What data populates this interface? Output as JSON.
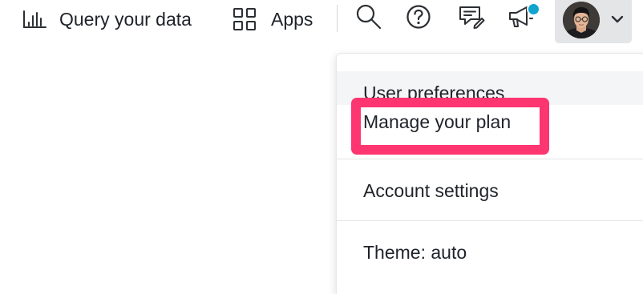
{
  "topbar": {
    "query_label": "Query your data",
    "query_icon": "bar-chart-icon",
    "apps_label": "Apps",
    "apps_icon": "grid-icon",
    "search_icon": "search-icon",
    "help_icon": "help-circle-icon",
    "feedback_icon": "feedback-icon",
    "announcements_icon": "megaphone-icon",
    "notification_color": "#10a4cf",
    "profile_icon": "avatar",
    "profile_menu_icon": "chevron-down-icon"
  },
  "user_menu": {
    "items": [
      {
        "label": "User preferences"
      },
      {
        "label": "Manage your plan",
        "highlighted": true
      },
      {
        "label": "Account settings"
      },
      {
        "label": "Theme: auto"
      }
    ],
    "highlight_color": "#fd3570"
  }
}
